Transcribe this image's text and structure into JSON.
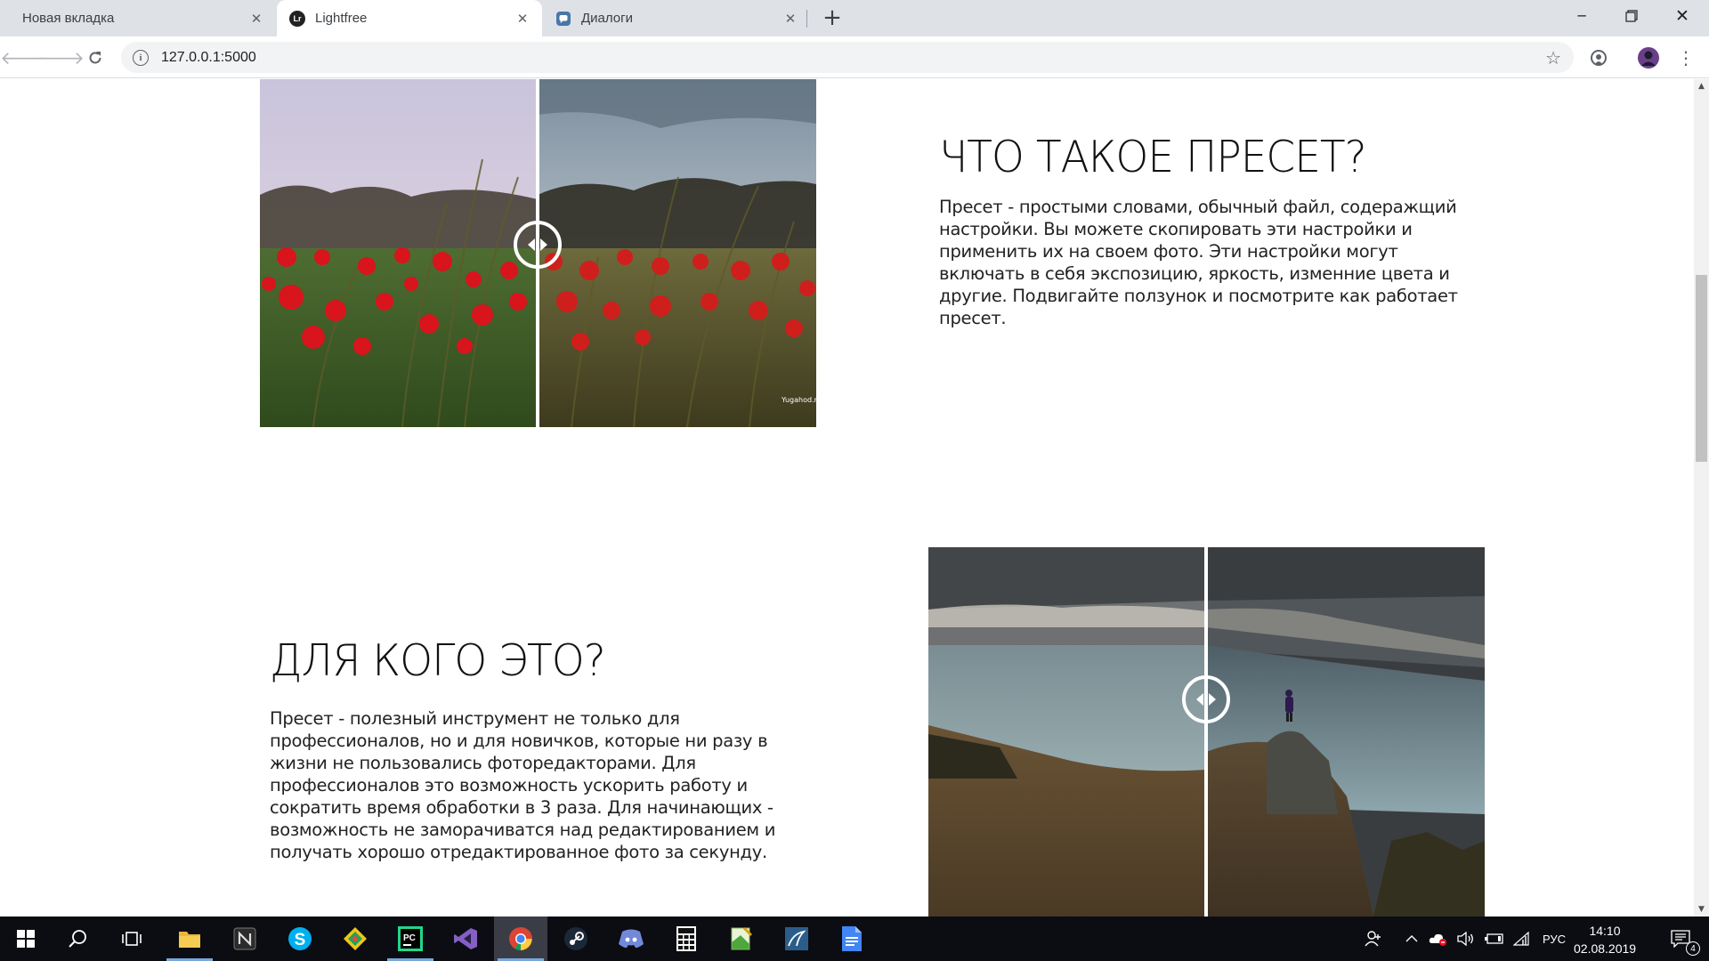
{
  "browser": {
    "tabs": [
      {
        "title": "Новая вкладка",
        "active": false
      },
      {
        "title": "Lightfree",
        "active": true,
        "favicon_text": "Lr"
      },
      {
        "title": "Диалоги",
        "active": false
      }
    ],
    "url": "127.0.0.1:5000"
  },
  "page": {
    "section1": {
      "heading": "ЧТО ТАКОЕ ПРЕСЕТ?",
      "paragraph": "Пресет - простыми словами, обычный файл, содеражщий настройки. Вы можете скопировать эти настройки и применить их на своем фото. Эти настройки могут включать в себя экспозицию, яркость, изменние цвета и другие. Подвигайте ползунок и посмотрите как работает пресет.",
      "image_watermark": "Yugahod.ru"
    },
    "section2": {
      "heading": "ДЛЯ КОГО ЭТО?",
      "paragraph": "Пресет - полезный инструмент не только для профессионалов, но и для новичков, которые ни разу в жизни не пользовались фоторедакторами. Для профессионалов это возможность ускорить работу и сократить время обработки в 3 раза. Для начинающих - возможность не заморачиватся над редактированием и получать хорошо отредактированное фото за секунду."
    }
  },
  "taskbar": {
    "apps": [
      "start-icon",
      "search-icon",
      "task-view-icon",
      "file-explorer-icon",
      "notion-icon",
      "skype-icon",
      "git-kraken-icon",
      "pycharm-icon",
      "visual-studio-icon",
      "chrome-icon",
      "steam-icon",
      "discord-icon",
      "calculator-icon",
      "notepad-icon",
      "mysql-workbench-icon",
      "google-docs-icon"
    ],
    "language": "РУС",
    "time": "14:10",
    "date": "02.08.2019",
    "notification_count": "4"
  }
}
